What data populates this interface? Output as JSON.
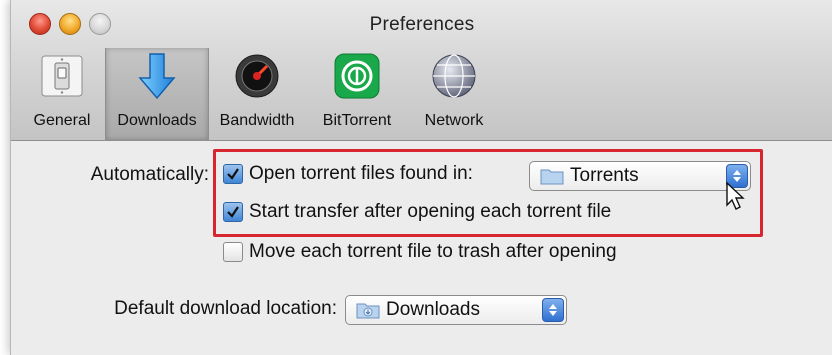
{
  "window": {
    "title": "Preferences"
  },
  "toolbar": {
    "items": [
      {
        "label": "General",
        "icon": "light-switch-icon",
        "selected": false
      },
      {
        "label": "Downloads",
        "icon": "download-arrow-icon",
        "selected": true
      },
      {
        "label": "Bandwidth",
        "icon": "speedometer-icon",
        "selected": false
      },
      {
        "label": "BitTorrent",
        "icon": "bittorrent-logo-icon",
        "selected": false
      },
      {
        "label": "Network",
        "icon": "globe-icon",
        "selected": false
      }
    ]
  },
  "downloads": {
    "automatically_label": "Automatically:",
    "open_torrent": {
      "label": "Open torrent files found in:",
      "checked": true
    },
    "torrent_folder": {
      "value": "Torrents",
      "icon": "folder-icon"
    },
    "start_transfer": {
      "label": "Start transfer after opening each torrent file",
      "checked": true
    },
    "move_to_trash": {
      "label": "Move each torrent file to trash after opening",
      "checked": false
    },
    "default_location_label": "Default download location:",
    "download_folder": {
      "value": "Downloads",
      "icon": "downloads-folder-icon"
    }
  },
  "colors": {
    "highlight_border": "#d7262f",
    "accent_blue": "#2f70d0"
  }
}
